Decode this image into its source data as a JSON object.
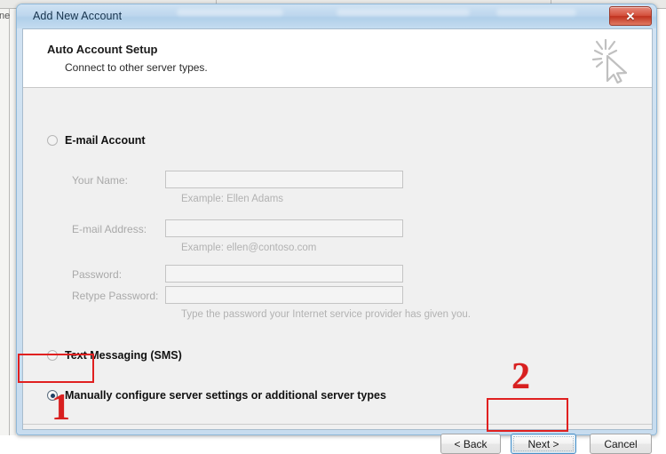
{
  "background": {
    "partial_text": "ne"
  },
  "window": {
    "title": "Add New Account",
    "close_label": "✕",
    "close_icon": "close-icon"
  },
  "header": {
    "title": "Auto Account Setup",
    "subtitle": "Connect to other server types.",
    "watermark_icon": "cursor-sparkle-icon"
  },
  "options": {
    "email_account": {
      "label": "E-mail Account",
      "selected": false
    },
    "text_messaging": {
      "label": "Text Messaging (SMS)",
      "selected": false
    },
    "manual_config": {
      "label": "Manually configure server settings or additional server types",
      "selected": true
    }
  },
  "fields": [
    {
      "label": "Your Name:",
      "value": "",
      "hint": "Example: Ellen Adams",
      "disabled": true
    },
    {
      "label": "E-mail Address:",
      "value": "",
      "hint": "Example: ellen@contoso.com",
      "disabled": true
    },
    {
      "label": "Password:",
      "value": "",
      "hint": "",
      "disabled": true
    },
    {
      "label": "Retype Password:",
      "value": "",
      "hint": "Type the password your Internet service provider has given you.",
      "disabled": true
    }
  ],
  "footer": {
    "back_label": "< Back",
    "next_label": "Next >",
    "cancel_label": "Cancel"
  },
  "annotations": {
    "step_one": "1",
    "step_two": "2",
    "color": "#d81f1f"
  }
}
